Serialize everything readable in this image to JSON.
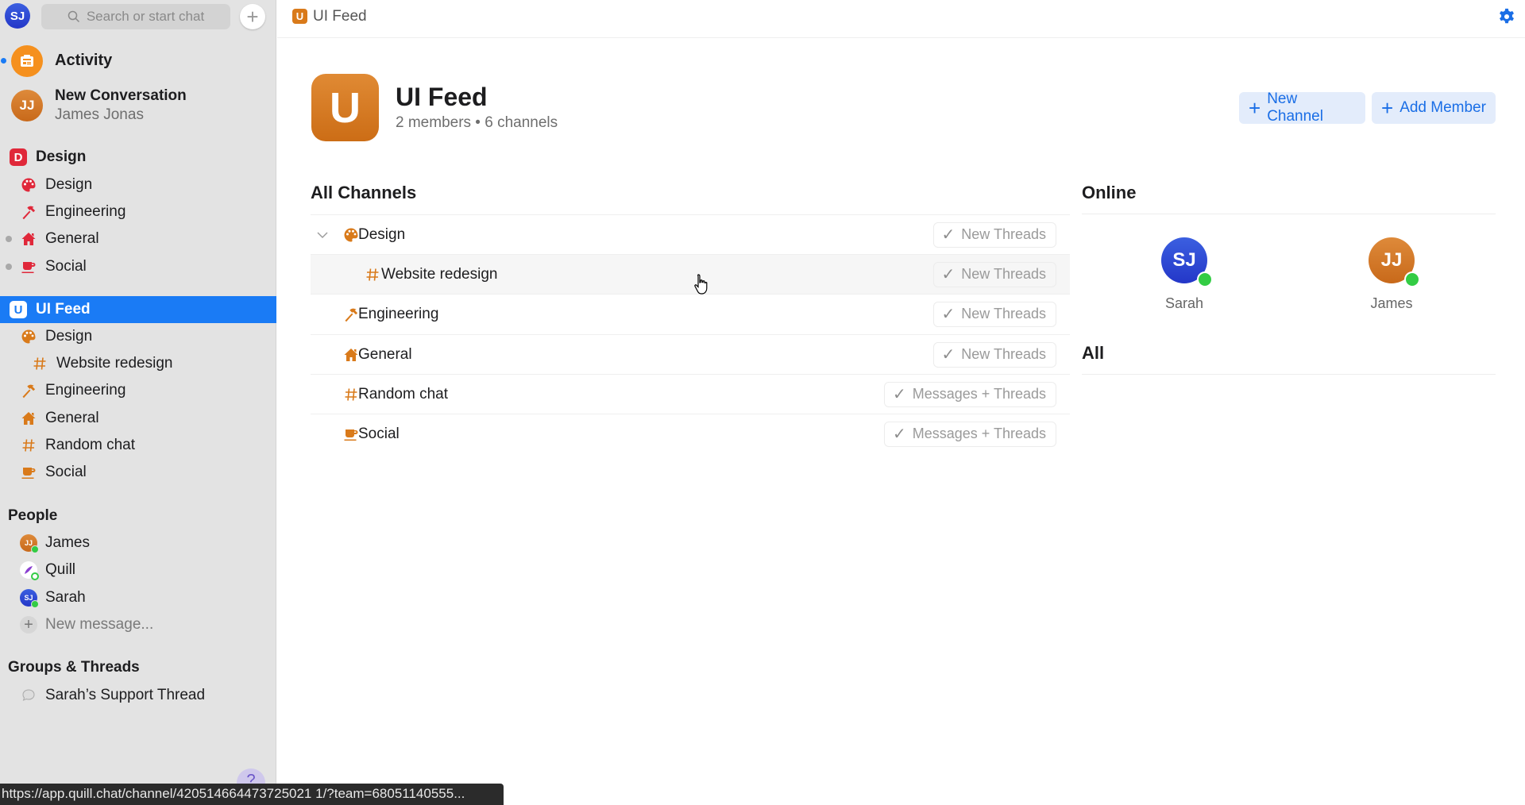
{
  "colors": {
    "accent": "#1a7bf5",
    "selected_row": "#1a7bf5",
    "design_group": "#e0283a",
    "feed_group": "#d97a1a",
    "online": "#33cc44"
  },
  "sidebar": {
    "user_initials": "SJ",
    "search_placeholder": "Search or start chat",
    "activity": {
      "label": "Activity",
      "icon": "newspaper-icon"
    },
    "conversation": {
      "title": "New Conversation",
      "subtitle": "James Jonas",
      "initials": "JJ"
    },
    "groups": [
      {
        "label": "Design",
        "letter": "D",
        "items": [
          {
            "label": "Design",
            "icon": "palette-icon"
          },
          {
            "label": "Engineering",
            "icon": "hammer-icon"
          },
          {
            "label": "General",
            "icon": "house-icon"
          },
          {
            "label": "Social",
            "icon": "cup-icon"
          }
        ]
      },
      {
        "label": "UI Feed",
        "letter": "U",
        "selected": true,
        "items": [
          {
            "label": "Design",
            "icon": "palette-icon"
          },
          {
            "label": "Website redesign",
            "icon": "hash-icon"
          },
          {
            "label": "Engineering",
            "icon": "hammer-icon"
          },
          {
            "label": "General",
            "icon": "house-icon"
          },
          {
            "label": "Random chat",
            "icon": "hash-icon"
          },
          {
            "label": "Social",
            "icon": "cup-icon"
          }
        ]
      }
    ],
    "people_header": "People",
    "people": [
      {
        "label": "James",
        "initials": "JJ"
      },
      {
        "label": "Quill"
      },
      {
        "label": "Sarah",
        "initials": "SJ"
      }
    ],
    "new_message": "New message...",
    "threads_header": "Groups & Threads",
    "threads": [
      {
        "label": "Sarah’s Support Thread"
      }
    ],
    "help": "?"
  },
  "status_url": "https://app.quill.chat/channel/420514664473725021 1/?team=68051140555...",
  "header": {
    "letter": "U",
    "title": "UI Feed"
  },
  "main": {
    "letter": "U",
    "title": "UI Feed",
    "subtitle": "2 members • 6 channels",
    "new_channel": "New Channel",
    "add_member": "Add Member",
    "channels_heading": "All Channels",
    "channels": [
      {
        "label": "Design",
        "icon": "palette-icon",
        "notify": "New Threads",
        "expanded": true
      },
      {
        "label": "Website redesign",
        "icon": "hash-icon",
        "notify": "New Threads"
      },
      {
        "label": "Engineering",
        "icon": "hammer-icon",
        "notify": "New Threads"
      },
      {
        "label": "General",
        "icon": "house-icon",
        "notify": "New Threads"
      },
      {
        "label": "Random chat",
        "icon": "hash-icon",
        "notify": "Messages + Threads"
      },
      {
        "label": "Social",
        "icon": "cup-icon",
        "notify": "Messages + Threads"
      }
    ],
    "online_heading": "Online",
    "online": [
      {
        "name": "Sarah",
        "initials": "SJ"
      },
      {
        "name": "James",
        "initials": "JJ"
      }
    ],
    "all_heading": "All"
  }
}
